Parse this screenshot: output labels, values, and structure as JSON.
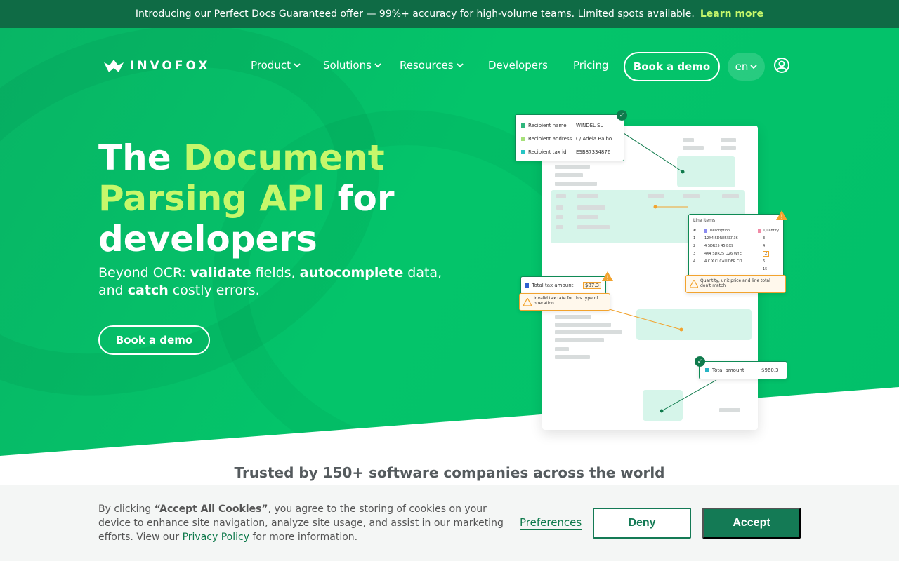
{
  "announcement": {
    "text": "Introducing our Perfect Docs Guaranteed offer — 99%+ accuracy for high-volume teams. Limited spots available.",
    "link": "Learn more"
  },
  "brand": {
    "name": "INVOFOX"
  },
  "nav": {
    "items": [
      {
        "label": "Product"
      },
      {
        "label": "Solutions"
      },
      {
        "label": "Resources"
      },
      {
        "label": "Developers"
      },
      {
        "label": "Pricing"
      }
    ],
    "cta": "Book a demo",
    "lang": "en"
  },
  "hero": {
    "title_part1": "The ",
    "title_highlight": "Document Parsing API",
    "title_part2": " for developers",
    "sub_prefix": "Beyond OCR: ",
    "sub_b1": "validate",
    "sub_m1": " fields, ",
    "sub_b2": "autocomplete",
    "sub_m2": " data, and ",
    "sub_b3": "catch",
    "sub_suffix": " costly errors.",
    "cta": "Book a demo"
  },
  "visual": {
    "recipient_card": [
      {
        "label": "Recipient name",
        "value": "WINDEL SL",
        "color": "#2fb67c"
      },
      {
        "label": "Recipient address",
        "value": "C/ Adela Balbo",
        "color": "#a6e07a"
      },
      {
        "label": "Recipient tax id",
        "value": "ESB87334876",
        "color": "#27c4c4"
      }
    ],
    "line_items": {
      "title": "Line items",
      "headers": [
        "#",
        "Description",
        "Quantity"
      ],
      "rows": [
        [
          "1",
          "12X4 SDR85XCR36",
          "3"
        ],
        [
          "2",
          "4 SDR25 45 BX9",
          "4"
        ],
        [
          "3",
          "4X4 SDR25 Q26 WYE",
          "2"
        ],
        [
          "4",
          "4 C X CI CALLDER CO",
          "6"
        ],
        [
          "",
          "",
          "15"
        ]
      ],
      "warning": "Quantity, unit price and line total don't match"
    },
    "tax_card": {
      "label": "Total tax amount",
      "value": "$87.3",
      "warning": "Invalid tax rate for this type of operation"
    },
    "total_card": {
      "label": "Total amount",
      "value": "$960.3"
    }
  },
  "trusted": "Trusted by 150+ software companies across the world",
  "cookie": {
    "text_pre": "By clicking ",
    "text_bold": "“Accept All Cookies”",
    "text_post": ", you agree to the storing of cookies on your device to enhance site navigation, analyze site usage, and assist in our marketing efforts. View our ",
    "policy_link": "Privacy Policy",
    "text_end": " for more information.",
    "preferences": "Preferences",
    "deny": "Deny",
    "accept": "Accept"
  },
  "colors": {
    "hero_green": "#04c46a",
    "announce_bg": "#0f6b45",
    "highlight": "#c6f76b",
    "button_green": "#147a55"
  }
}
